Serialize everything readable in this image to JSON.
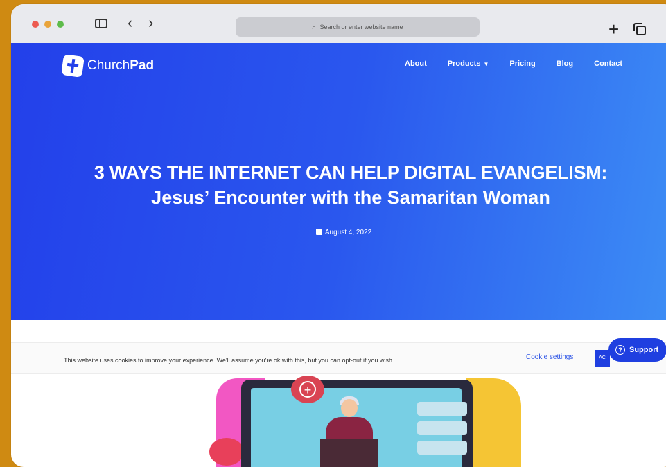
{
  "browser": {
    "address_placeholder": "Search or enter website name",
    "controls": [
      "close",
      "minimize",
      "maximize"
    ]
  },
  "site": {
    "logo_text_regular": "Church",
    "logo_text_bold": "Pad",
    "nav": {
      "about": "About",
      "products": "Products",
      "pricing": "Pricing",
      "blog": "Blog",
      "contact": "Contact"
    }
  },
  "article": {
    "title_line1": "3 WAYS THE INTERNET CAN HELP DIGITAL EVANGELISM:",
    "title_line2": "Jesus’ Encounter with the Samaritan Woman",
    "date": "August 4, 2022"
  },
  "cookie": {
    "message": "This website uses cookies to improve your experience. We'll assume you're ok with this, but you can opt-out if you wish.",
    "settings_label": "Cookie settings",
    "accept_label": "AC"
  },
  "support": {
    "label": "Support"
  },
  "colors": {
    "background": "#cf8a12",
    "brand_blue": "#2340ea",
    "hero_gradient_end": "#3d8ef5",
    "illustration_pink": "#f257c3",
    "illustration_yellow": "#f5c534"
  },
  "icons": [
    "search-icon",
    "sidebar-icon",
    "chevron-left-icon",
    "chevron-right-icon",
    "plus-icon",
    "tabs-icon",
    "calendar-icon",
    "question-icon",
    "caret-down-icon"
  ]
}
